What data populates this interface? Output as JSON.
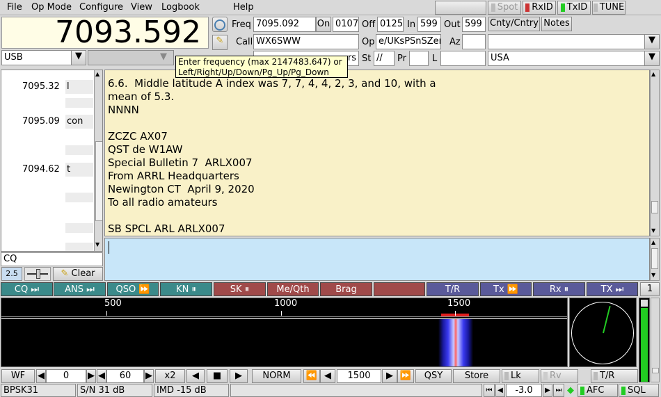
{
  "menu": {
    "file": "File",
    "opmode": "Op Mode",
    "configure": "Configure",
    "view": "View",
    "logbook": "Logbook",
    "help": "Help",
    "spot": "Spot",
    "rxid": "RxID",
    "txid": "TxID",
    "tune": "TUNE"
  },
  "freq_display": "7093.592",
  "mode": "USB",
  "log": {
    "freq_label": "Freq",
    "freq": "7095.092",
    "on_label": "On",
    "on": "0107",
    "off_label": "Off",
    "off": "0125",
    "in_label": "In",
    "in": "599",
    "out_label": "Out",
    "out": "599",
    "call_label": "Call",
    "call": "WX6SWW",
    "op_label": "Op",
    "op": "e/UKsPSnSZers",
    "az_label": "Az",
    "az": "",
    "st_label": "St",
    "st": "//",
    "pr_label": "Pr",
    "pr": "",
    "l_label": "L",
    "l": "",
    "country": "USA",
    "name_tail": "rs"
  },
  "tabs": {
    "cnty": "Cnty/Cntry",
    "notes": "Notes"
  },
  "tooltip": {
    "line1": "Enter frequency (max 2147483.647) or",
    "line2": "Left/Right/Up/Down/Pg_Up/Pg_Down"
  },
  "browser": [
    {
      "freq": "7095.32",
      "text": "l"
    },
    {
      "freq": "7095.09",
      "text": "con"
    },
    {
      "freq": "7094.62",
      "text": "t"
    }
  ],
  "search": "CQ",
  "squelch_value": "2.5",
  "clear_label": "Clear",
  "rx_text": [
    "6.6.  Middle latitude A index was 7, 7, 4, 4, 2, 3, and 10, with a",
    "mean of 5.3.",
    "NNNN",
    "",
    "ZCZC AX07",
    "QST de W1AW",
    "Special Bulletin 7  ARLX007",
    "From ARRL Headquarters",
    "Newington CT  April 9, 2020",
    "To all radio amateurs",
    "",
    "SB SPCL ARL ARLX007"
  ],
  "macros": [
    {
      "label": "CQ ⏭",
      "color": "#3b8a8a"
    },
    {
      "label": "ANS ⏭",
      "color": "#3b8a8a"
    },
    {
      "label": "QSO ⏩",
      "color": "#3b8a8a"
    },
    {
      "label": "KN ⏸",
      "color": "#3b8a8a"
    },
    {
      "label": "SK ⏸",
      "color": "#a04a4a"
    },
    {
      "label": "Me/Qth",
      "color": "#a04a4a"
    },
    {
      "label": "Brag",
      "color": "#a04a4a"
    },
    {
      "label": "",
      "color": "#a04a4a"
    },
    {
      "label": "T/R",
      "color": "#5a5a9a"
    },
    {
      "label": "Tx ⏩",
      "color": "#5a5a9a"
    },
    {
      "label": "Rx ⏸",
      "color": "#5a5a9a"
    },
    {
      "label": "TX ⏭",
      "color": "#5a5a9a"
    }
  ],
  "macro_page": "1",
  "scale_labels": [
    "500",
    "1000",
    "1500"
  ],
  "controls": {
    "wf": "WF",
    "wf_val": "0",
    "range_val": "60",
    "x2": "x2",
    "norm": "NORM",
    "carrier": "1500",
    "qsy": "QSY",
    "store": "Store",
    "lk": "Lk",
    "rv": "Rv",
    "tr": "T/R"
  },
  "status": {
    "mode": "BPSK31",
    "sn": "S/N 31 dB",
    "imd": "IMD -15 dB",
    "msg": "",
    "att": "-3.0",
    "afc": "AFC",
    "sql": "SQL"
  },
  "colors": {
    "log_bg": "#fffde6",
    "rx_bg": "#f9f1c8",
    "tx_bg": "#c8e6f9",
    "afc_on": "#22cc22",
    "waterfall_bg": "#000000",
    "signal_marker": "#e02020"
  }
}
